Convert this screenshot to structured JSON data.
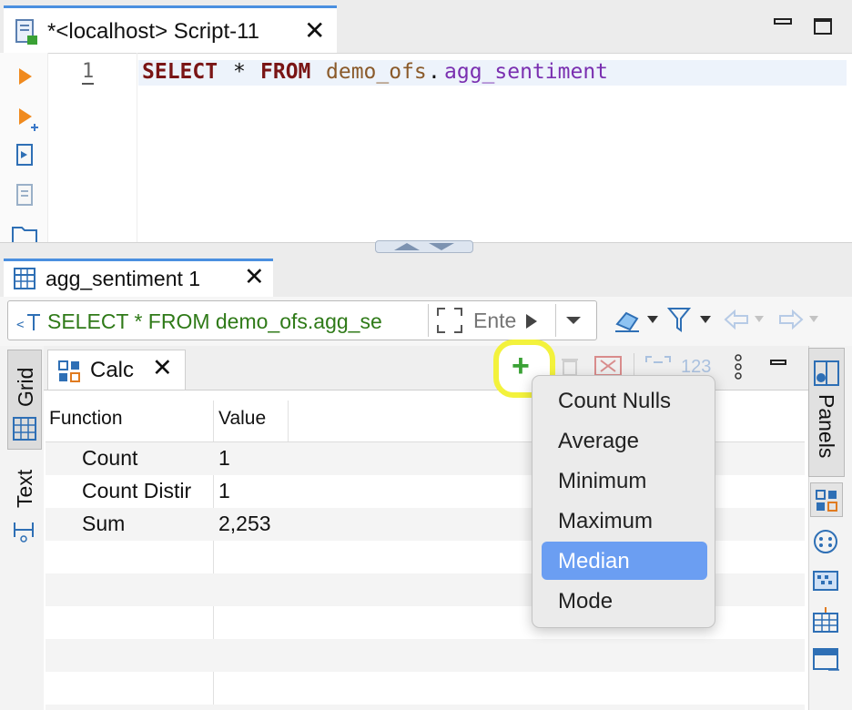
{
  "editor_tab": {
    "title": "*<localhost> Script-11",
    "close": "✕"
  },
  "editor": {
    "line_number": "1",
    "sql": {
      "select": "SELECT",
      "star": "*",
      "from": "FROM",
      "schema": "demo_ofs",
      "dot": ".",
      "table": "agg_sentiment"
    }
  },
  "results_tab": {
    "title": "agg_sentiment 1",
    "close": "✕"
  },
  "filter": {
    "query": "SELECT * FROM demo_ofs.agg_se",
    "placeholder": "Ente"
  },
  "left_tabs": {
    "grid": "Grid",
    "text": "Text"
  },
  "calc_tab": {
    "title": "Calc",
    "close": "✕"
  },
  "toolbar": {
    "add_label": "+",
    "value_label": "123"
  },
  "calc_table": {
    "headers": {
      "function": "Function",
      "value": "Value"
    },
    "rows": [
      {
        "function": "Count",
        "value": "1"
      },
      {
        "function": "Count Distir",
        "value": "1"
      },
      {
        "function": "Sum",
        "value": "2,253"
      }
    ]
  },
  "right_tabs": {
    "panels": "Panels"
  },
  "menu": {
    "items": [
      "Count Nulls",
      "Average",
      "Minimum",
      "Maximum",
      "Median",
      "Mode"
    ],
    "selected": "Median"
  },
  "colors": {
    "accent": "#4a8fe0",
    "menu_highlight": "#6b9ef2",
    "add_icon": "#3aa135",
    "highlight_ring": "#f3f23c"
  }
}
